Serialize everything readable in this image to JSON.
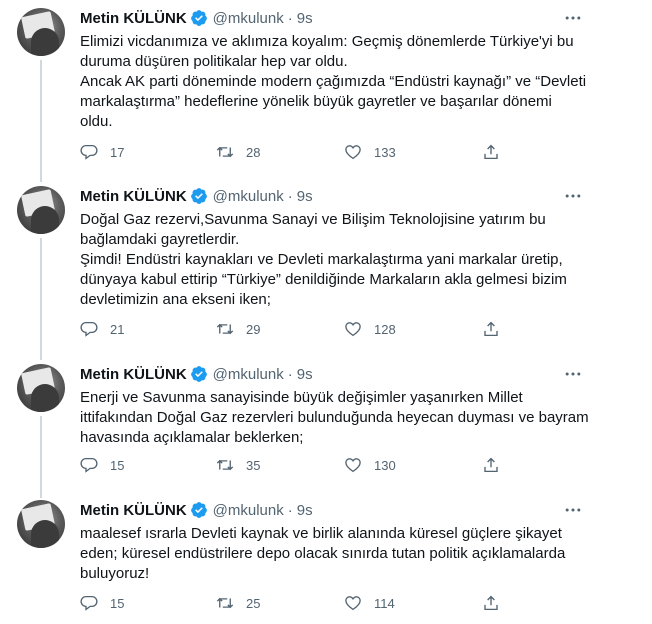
{
  "tweets": [
    {
      "name": "Metin KÜLÜNK",
      "handle": "@mkulunk",
      "separator": "·",
      "time": "9s",
      "text": "Elimizi vicdanımıza ve aklımıza koyalım: Geçmiş dönemlerde Türkiye'yi bu\nduruma düşüren politikalar hep var oldu.\nAncak AK parti döneminde modern çağımızda “Endüstri kaynağı” ve “Devleti\nmarkalaştırma” hedeflerine yönelik büyük gayretler ve başarılar dönemi\noldu.",
      "replies": "17",
      "retweets": "28",
      "likes": "133"
    },
    {
      "name": "Metin KÜLÜNK",
      "handle": "@mkulunk",
      "separator": "·",
      "time": "9s",
      "text": "Doğal Gaz rezervi,Savunma Sanayi ve Bilişim Teknolojisine yatırım bu\nbağlamdaki gayretlerdir.\nŞimdi! Endüstri kaynakları ve Devleti markalaştırma yani markalar üretip,\ndünyaya kabul ettirip “Türkiye” denildiğinde Markaların akla gelmesi bizim\ndevletimizin ana ekseni iken;",
      "replies": "21",
      "retweets": "29",
      "likes": "128"
    },
    {
      "name": "Metin KÜLÜNK",
      "handle": "@mkulunk",
      "separator": "·",
      "time": "9s",
      "text": "Enerji ve Savunma sanayisinde büyük değişimler yaşanırken Millet\nittifakından Doğal Gaz rezervleri bulunduğunda heyecan duyması ve bayram\nhavasında açıklamalar beklerken;",
      "replies": "15",
      "retweets": "35",
      "likes": "130"
    },
    {
      "name": "Metin KÜLÜNK",
      "handle": "@mkulunk",
      "separator": "·",
      "time": "9s",
      "text": "maalesef ısrarla Devleti kaynak ve birlik alanında küresel güçlere şikayet\neden; küresel endüstrilere depo olacak sınırda tutan politik açıklamalarda\nbuluyoruz!",
      "replies": "15",
      "retweets": "25",
      "likes": "114"
    }
  ],
  "colors": {
    "text": "#0f1419",
    "secondary": "#536471",
    "verified": "#1d9bf0",
    "thread_line": "#cfd9de"
  },
  "icons": [
    "verified-badge-icon",
    "more-icon",
    "reply-icon",
    "retweet-icon",
    "like-icon",
    "share-icon"
  ]
}
